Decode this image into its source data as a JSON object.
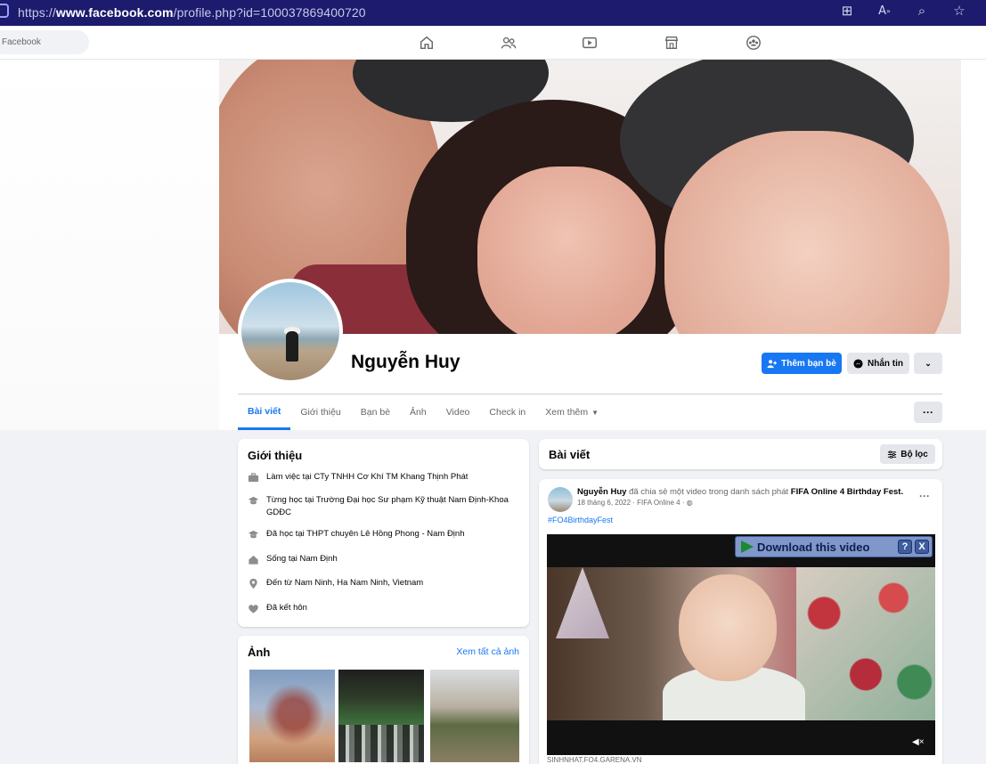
{
  "browser": {
    "url_prefix": "https://",
    "url_domain": "www.facebook.com",
    "url_path": "/profile.php?id=100037869400720",
    "icons": [
      "apps-icon",
      "read-aloud-icon",
      "zoom-icon",
      "favorite-star-icon"
    ]
  },
  "fb": {
    "search_placeholder": "Facebook",
    "nav_icons": [
      "home-icon",
      "friends-icon",
      "watch-icon",
      "marketplace-icon",
      "groups-icon"
    ]
  },
  "profile": {
    "name": "Nguyễn Huy",
    "add_friend_label": "Thêm bạn bè",
    "message_label": "Nhắn tin"
  },
  "tabs": [
    {
      "label": "Bài viết"
    },
    {
      "label": "Giới thiệu"
    },
    {
      "label": "Bạn bè"
    },
    {
      "label": "Ảnh"
    },
    {
      "label": "Video"
    },
    {
      "label": "Check in"
    },
    {
      "label": "Xem thêm"
    }
  ],
  "intro": {
    "title": "Giới thiệu",
    "items": [
      {
        "icon": "work-icon",
        "text": "Làm việc tại CTy TNHH Cơ Khí TM Khang Thịnh Phát"
      },
      {
        "icon": "education-icon",
        "text": "Từng học tại Trường Đại học Sư phạm Kỹ thuật Nam Định-Khoa GDĐC"
      },
      {
        "icon": "education-icon",
        "text": "Đã học tại THPT chuyên Lê Hồng Phong - Nam Định"
      },
      {
        "icon": "home-location-icon",
        "text": "Sống tại Nam Định"
      },
      {
        "icon": "location-pin-icon",
        "text": "Đến từ Nam Ninh, Ha Nam Ninh, Vietnam"
      },
      {
        "icon": "heart-icon",
        "text": "Đã kết hôn"
      }
    ]
  },
  "photos": {
    "title": "Ảnh",
    "see_all": "Xem tất cả ảnh"
  },
  "posts": {
    "title": "Bài viết",
    "filter_label": "Bộ lọc"
  },
  "post": {
    "author": "Nguyễn Huy",
    "action": " đã chia sẻ một video trong danh sách phát ",
    "playlist": "FIFA Online 4 Birthday Fest",
    "date_line": "18 tháng 6, 2022 · FIFA Online 4 ·",
    "hashtag": "#FO4BirthdayFest",
    "download_label": "Download this video",
    "caption": "SINHNHAT.FO4.GARENA.VN"
  }
}
